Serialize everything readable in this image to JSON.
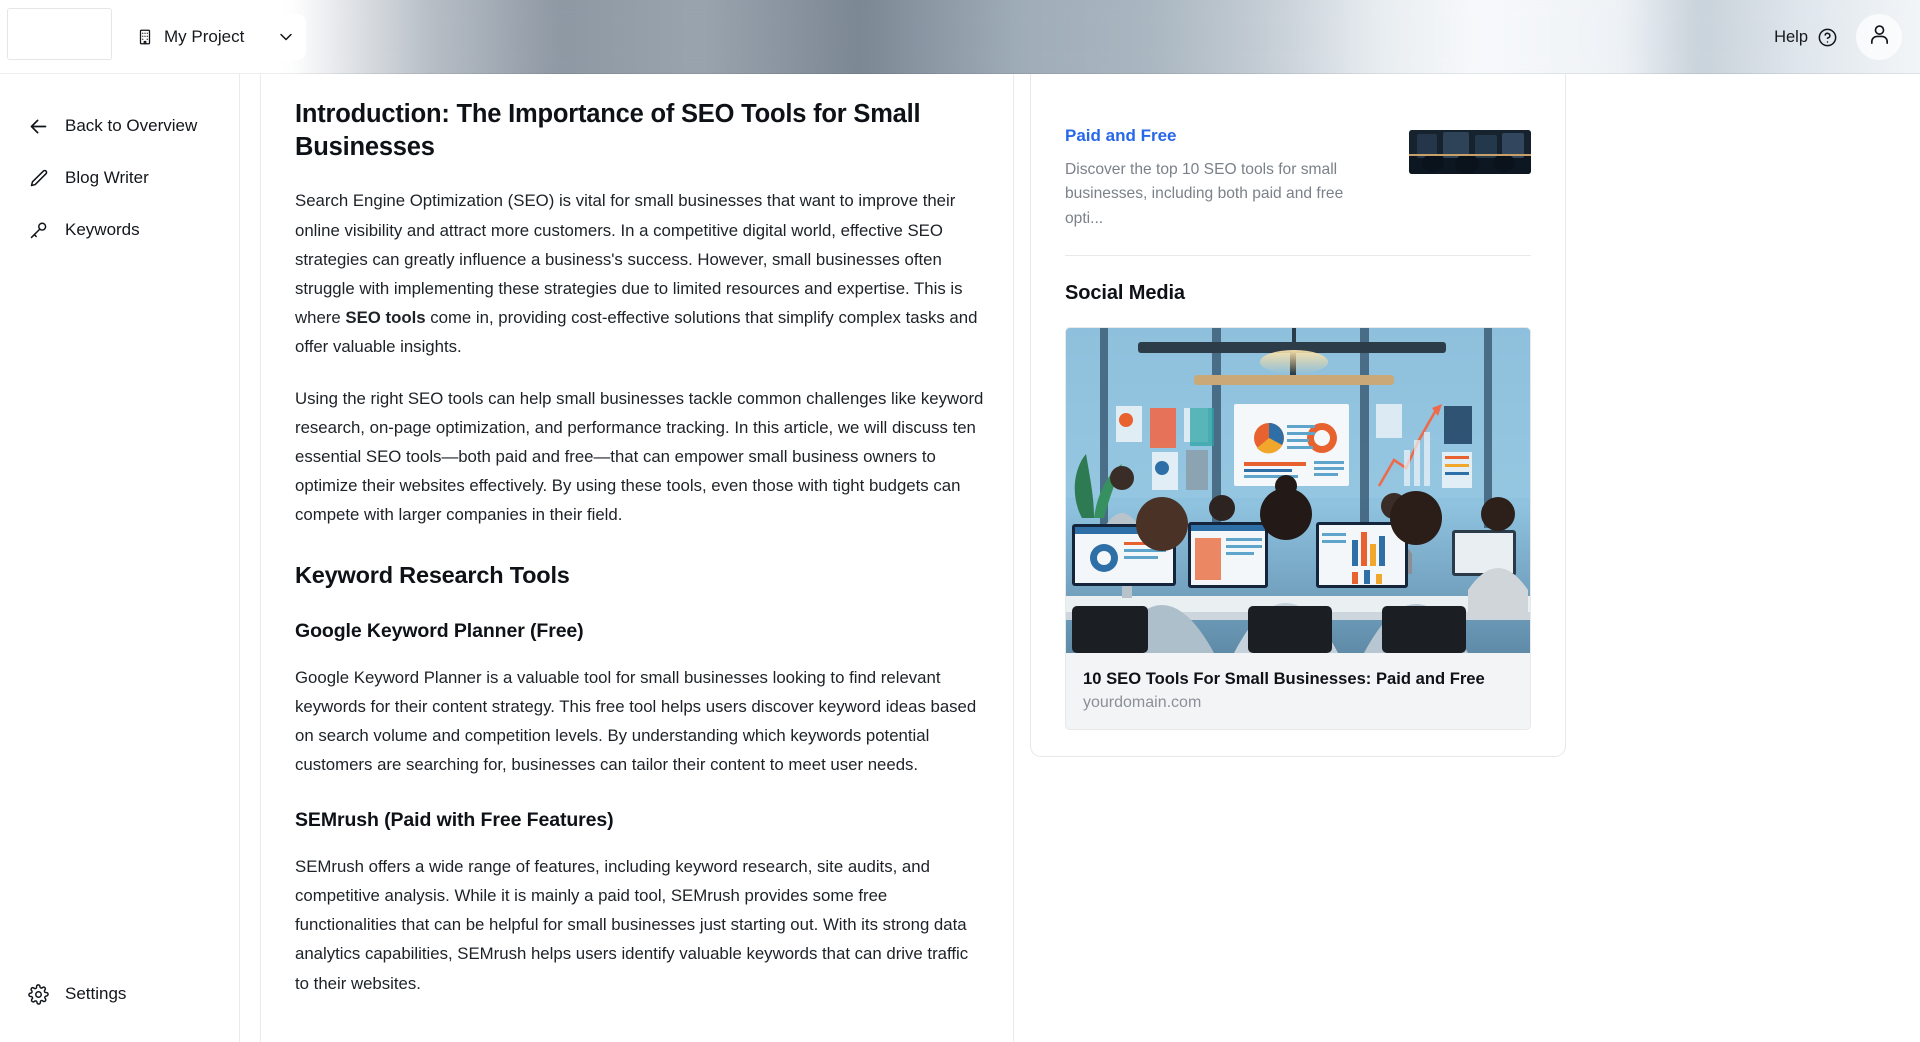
{
  "header": {
    "logo_placeholder": "",
    "project": {
      "name": "My Project",
      "icon": "building-icon",
      "chevron": "chevron-down-icon"
    },
    "help": {
      "label": "Help",
      "icon": "question-circle-icon"
    },
    "account": {
      "icon": "user-avatar-icon"
    },
    "blurred_region": true
  },
  "sidebar": {
    "items": [
      {
        "label": "Back to Overview",
        "icon": "arrow-left-icon"
      },
      {
        "label": "Blog Writer",
        "icon": "pencil-icon"
      },
      {
        "label": "Keywords",
        "icon": "key-icon"
      }
    ],
    "bottom_items": [
      {
        "label": "Settings",
        "icon": "gear-icon"
      }
    ]
  },
  "article": {
    "blocks": [
      {
        "type": "h1",
        "text": "Introduction: The Importance of SEO Tools for Small Businesses"
      },
      {
        "type": "p",
        "pre": "Search Engine Optimization (SEO) is vital for small businesses that want to improve their online visibility and attract more customers. In a competitive digital world, effective SEO strategies can greatly influence a business's success. However, small businesses often struggle with implementing these strategies due to limited resources and expertise. This is where ",
        "bold": "SEO tools",
        "post": " come in, providing cost-effective solutions that simplify complex tasks and offer valuable insights."
      },
      {
        "type": "p",
        "text": "Using the right SEO tools can help small businesses tackle common challenges like keyword research, on-page optimization, and performance tracking. In this article, we will discuss ten essential SEO tools—both paid and free—that can empower small business owners to optimize their websites effectively. By using these tools, even those with tight budgets can compete with larger companies in their field."
      },
      {
        "type": "h2",
        "text": "Keyword Research Tools"
      },
      {
        "type": "h3",
        "text": "Google Keyword Planner (Free)"
      },
      {
        "type": "p",
        "text": "Google Keyword Planner is a valuable tool for small businesses looking to find relevant keywords for their content strategy. This free tool helps users discover keyword ideas based on search volume and competition levels. By understanding which keywords potential customers are searching for, businesses can tailor their content to meet user needs."
      },
      {
        "type": "h3",
        "text": "SEMrush (Paid with Free Features)"
      },
      {
        "type": "p",
        "text": "SEMrush offers a wide range of features, including keyword research, site audits, and competitive analysis. While it is mainly a paid tool, SEMrush provides some free functionalities that can be helpful for small businesses just starting out. With its strong data analytics capabilities, SEMrush helps users identify valuable keywords that can drive traffic to their websites."
      }
    ]
  },
  "right_panel": {
    "seo_preview": {
      "title": "Paid and Free",
      "description": "Discover the top 10 SEO tools for small businesses, including both paid and free opti...",
      "thumbnail_alt": "office-team-meeting-thumbnail"
    },
    "social_media": {
      "heading": "Social Media",
      "card": {
        "image_alt": "office-team-analytics-dashboards",
        "title": "10 SEO Tools For Small Businesses: Paid and Free",
        "domain": "yourdomain.com"
      }
    }
  },
  "colors": {
    "link_blue": "#2767e8",
    "muted_text": "#7b8189",
    "border": "#e6e8ea",
    "card_bg": "#f3f4f6"
  }
}
